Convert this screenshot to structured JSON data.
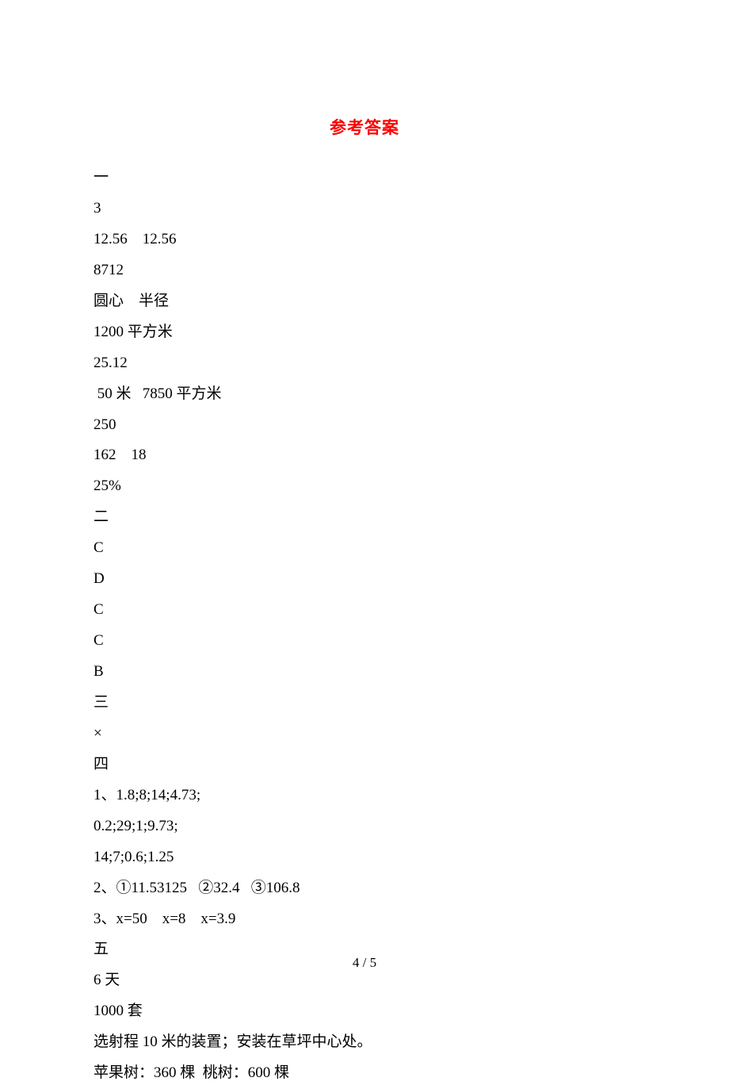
{
  "title": "参考答案",
  "section1": {
    "header": "一",
    "lines": [
      "3",
      "12.56    12.56",
      "8712",
      "圆心    半径",
      "1200 平方米",
      "25.12",
      " 50 米   7850 平方米",
      "250",
      "162    18",
      "25%"
    ]
  },
  "section2": {
    "header": "二",
    "lines": [
      "C",
      "D",
      "C",
      "C",
      "B"
    ]
  },
  "section3": {
    "header": "三",
    "lines": [
      "×"
    ]
  },
  "section4": {
    "header": "四",
    "lines": [
      "1、1.8;8;14;4.73;",
      "0.2;29;1;9.73;",
      "14;7;0.6;1.25",
      "2、①11.53125   ②32.4   ③106.8",
      "3、x=50    x=8    x=3.9"
    ]
  },
  "section5": {
    "header": "五",
    "lines": [
      "6 天",
      "1000 套",
      "选射程 10 米的装置；安装在草坪中心处。",
      "苹果树：360 棵  桃树：600 棵"
    ]
  },
  "page_number": "4 / 5"
}
